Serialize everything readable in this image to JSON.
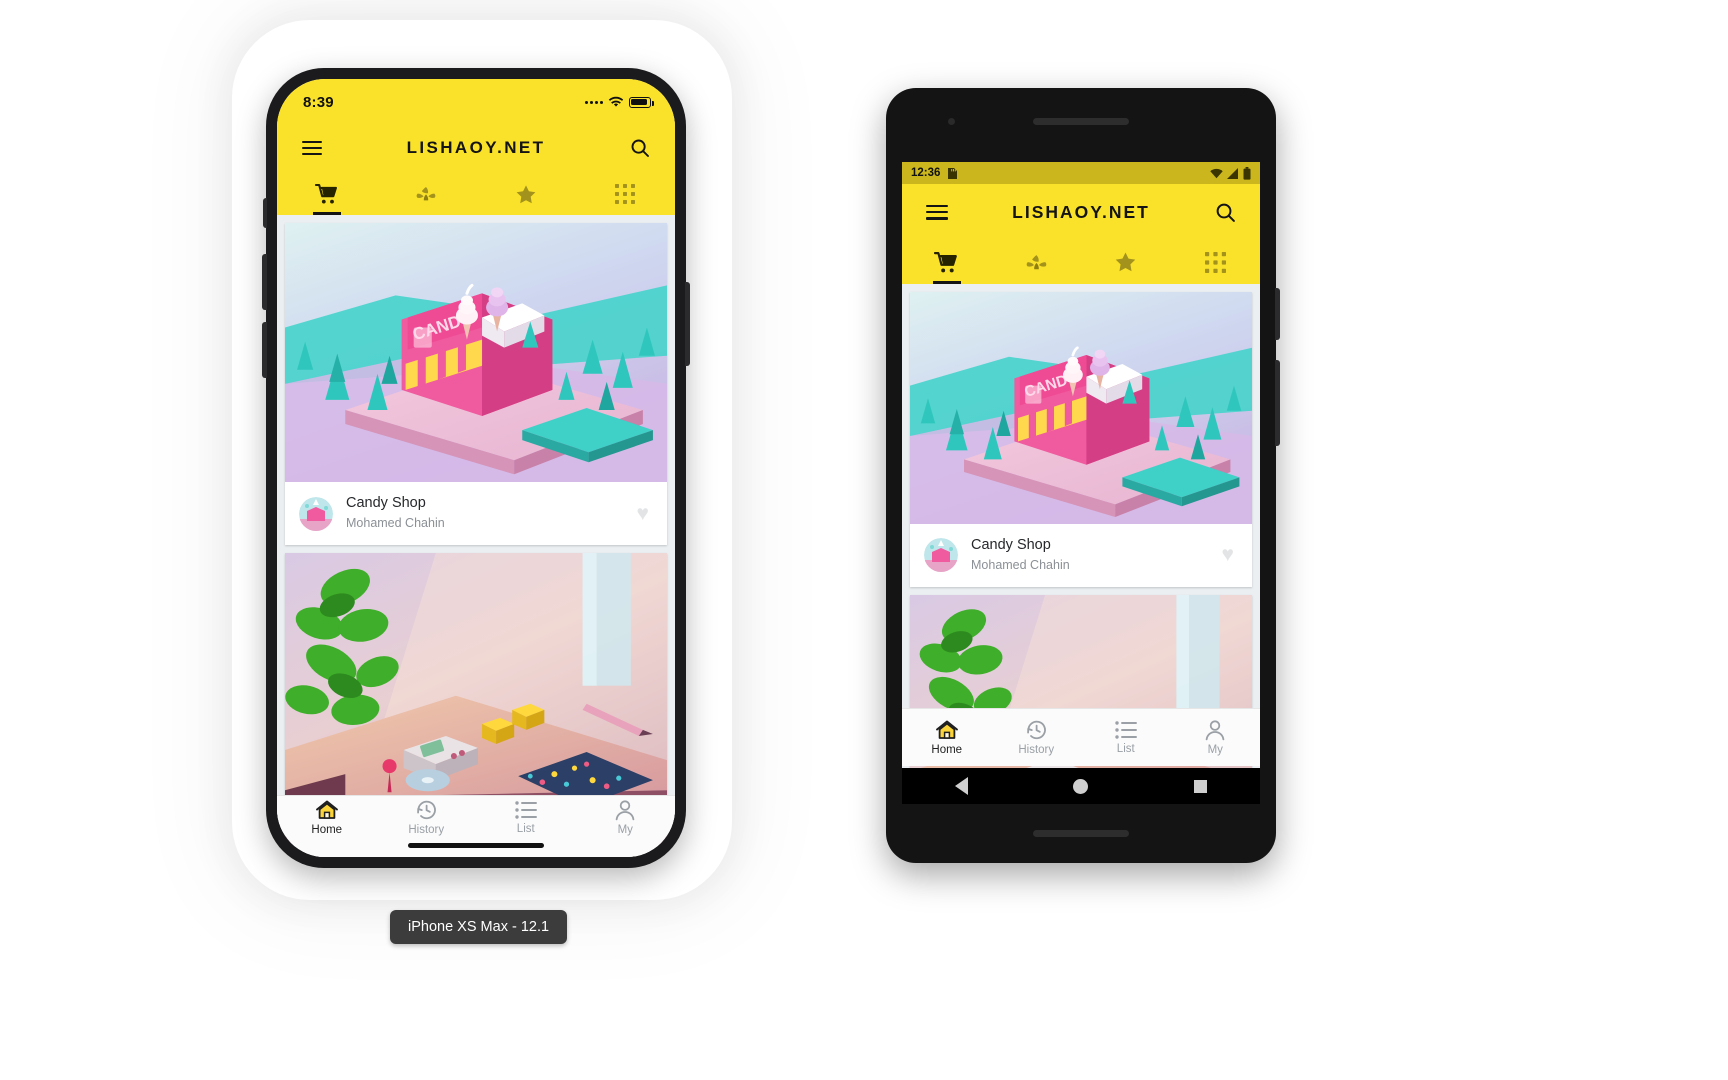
{
  "app": {
    "brand": "LISHAOY.NET",
    "accent_yellow": "#FBE22A",
    "status_yellow_android": "#CBB71D",
    "text_dark": "#141414",
    "muted_text": "#9AA0A6"
  },
  "iphone": {
    "caption": "iPhone XS Max - 12.1",
    "status": {
      "time": "8:39",
      "signal_icon": "signal-dots-icon",
      "wifi_icon": "wifi-icon",
      "battery_icon": "battery-icon"
    },
    "appbar": {
      "menu_icon": "hamburger-menu-icon",
      "title": "LISHAOY.NET",
      "search_icon": "search-icon"
    },
    "category_tabs": [
      {
        "name": "cart-tab",
        "icon": "shopping-cart-icon",
        "active": true
      },
      {
        "name": "plant-tab",
        "icon": "leaf-icon",
        "active": false
      },
      {
        "name": "star-tab",
        "icon": "star-icon",
        "active": false
      },
      {
        "name": "grid-tab",
        "icon": "grid-icon",
        "active": false
      }
    ],
    "cards": [
      {
        "image_alt": "isometric-candy-shop-illustration",
        "title": "Candy Shop",
        "author": "Mohamed Chahin",
        "favorite_icon": "heart-icon"
      },
      {
        "image_alt": "isometric-desk-with-handheld-console-illustration",
        "title": "",
        "author": "",
        "favorite_icon": "heart-icon"
      }
    ],
    "bottom_nav": [
      {
        "label": "Home",
        "icon": "home-icon",
        "active": true
      },
      {
        "label": "History",
        "icon": "clock-history-icon",
        "active": false
      },
      {
        "label": "List",
        "icon": "list-icon",
        "active": false
      },
      {
        "label": "My",
        "icon": "person-icon",
        "active": false
      }
    ]
  },
  "android": {
    "status": {
      "time": "12:36",
      "sdcard_icon": "sd-card-icon",
      "wifi_icon": "wifi-icon",
      "signal_icon": "signal-bars-icon",
      "battery_icon": "battery-icon"
    },
    "appbar": {
      "menu_icon": "hamburger-menu-icon",
      "title": "LISHAOY.NET",
      "search_icon": "search-icon"
    },
    "category_tabs": [
      {
        "name": "cart-tab",
        "icon": "shopping-cart-icon",
        "active": true
      },
      {
        "name": "plant-tab",
        "icon": "leaf-icon",
        "active": false
      },
      {
        "name": "star-tab",
        "icon": "star-icon",
        "active": false
      },
      {
        "name": "grid-tab",
        "icon": "grid-icon",
        "active": false
      }
    ],
    "cards": [
      {
        "image_alt": "isometric-candy-shop-illustration",
        "title": "Candy Shop",
        "author": "Mohamed Chahin",
        "favorite_icon": "heart-icon"
      },
      {
        "image_alt": "isometric-desk-with-handheld-console-illustration",
        "title": "",
        "author": "",
        "favorite_icon": "heart-icon"
      }
    ],
    "bottom_nav": [
      {
        "label": "Home",
        "icon": "home-icon",
        "active": true
      },
      {
        "label": "History",
        "icon": "clock-history-icon",
        "active": false
      },
      {
        "label": "List",
        "icon": "list-icon",
        "active": false
      },
      {
        "label": "My",
        "icon": "person-icon",
        "active": false
      }
    ],
    "system_nav": [
      {
        "name": "back-button",
        "icon": "triangle-back-icon"
      },
      {
        "name": "home-button",
        "icon": "circle-home-icon"
      },
      {
        "name": "recents-button",
        "icon": "square-recents-icon"
      }
    ]
  }
}
